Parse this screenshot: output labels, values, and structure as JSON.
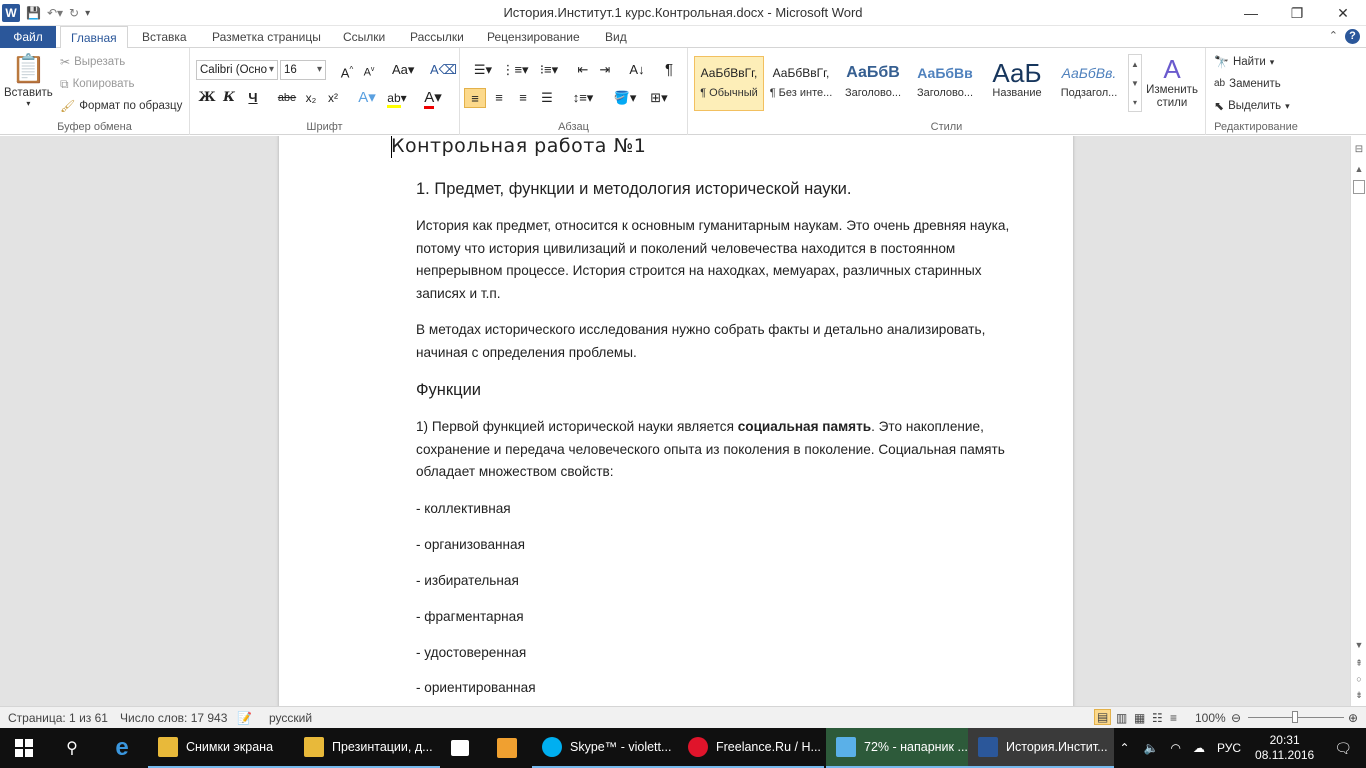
{
  "window": {
    "title": "История.Институт.1 курс.Контрольная.docx - Microsoft Word"
  },
  "tabs": [
    "Файл",
    "Главная",
    "Вставка",
    "Разметка страницы",
    "Ссылки",
    "Рассылки",
    "Рецензирование",
    "Вид"
  ],
  "clipboard": {
    "paste": "Вставить",
    "cut": "Вырезать",
    "copy": "Копировать",
    "format_painter": "Формат по образцу",
    "label": "Буфер обмена"
  },
  "font": {
    "name": "Calibri (Осно",
    "size": "16",
    "label": "Шрифт",
    "bold": "Ж",
    "italic": "К",
    "underline": "Ч",
    "strike": "abe",
    "sub": "x₂",
    "sup": "x²"
  },
  "paragraph": {
    "label": "Абзац",
    "pilcrow": "¶"
  },
  "styles": {
    "label": "Стили",
    "items": [
      {
        "sample": "АаБбВвГг,",
        "name": "¶ Обычный"
      },
      {
        "sample": "АаБбВвГг,",
        "name": "¶ Без инте..."
      },
      {
        "sample": "АаБбВ",
        "name": "Заголово..."
      },
      {
        "sample": "АаБбВв",
        "name": "Заголово..."
      },
      {
        "sample": "АаБ",
        "name": "Название"
      },
      {
        "sample": "АаБбВв.",
        "name": "Подзагол..."
      }
    ],
    "change": "Изменить стили"
  },
  "editing": {
    "find": "Найти",
    "replace": "Заменить",
    "select": "Выделить",
    "label": "Редактирование"
  },
  "document": {
    "title": "Контрольная работа №1",
    "heading1": "1.  Предмет, функции и методология исторической науки.",
    "p1": "История как предмет, относится к основным гуманитарным наукам. Это очень древняя наука, потому что история цивилизаций и поколений человечества находится в постоянном непрерывном процессе. История строится на находках, мемуарах, различных старинных записях и т.п.",
    "p2": "В методах исторического исследования нужно собрать факты и детально анализировать, начиная с определения проблемы.",
    "heading2": "Функции",
    "p3_before": "1) Первой функцией исторической науки является ",
    "p3_bold": "социальная память",
    "p3_after": ". Это накопление, сохранение и передача человеческого опыта из поколения в поколение. Социальная память обладает множеством свойств:",
    "list": [
      "- коллективная",
      "- организованная",
      "- избирательная",
      "- фрагментарная",
      "- удостоверенная",
      "- ориентированная"
    ]
  },
  "status": {
    "page": "Страница: 1 из 61",
    "words": "Число слов: 17 943",
    "lang": "русский",
    "zoom": "100%"
  },
  "taskbar": {
    "items": [
      "Снимки экрана",
      "Презинтации, д...",
      "Skype™ - violett...",
      "Freelance.Ru / Н...",
      "72% - напарник ...",
      "История.Инстит..."
    ],
    "lang": "РУС",
    "time": "20:31",
    "date": "08.11.2016"
  }
}
